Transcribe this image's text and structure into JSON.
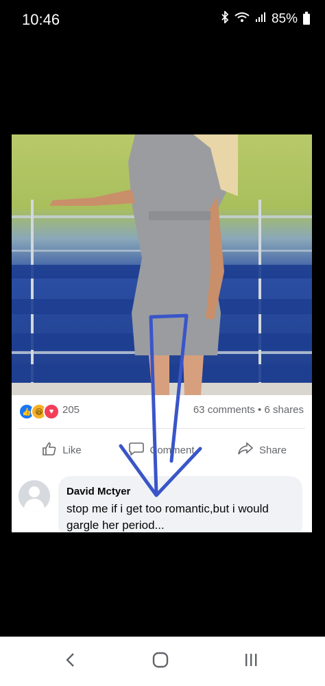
{
  "status_bar": {
    "time": "10:46",
    "battery_percent": "85%",
    "icons": [
      "bluetooth-icon",
      "wifi-icon",
      "signal-icon",
      "battery-icon"
    ]
  },
  "post": {
    "reaction_count": "205",
    "comments_shares": "63 comments • 6 shares",
    "reactions": [
      "like",
      "haha",
      "love"
    ],
    "actions": {
      "like": "Like",
      "comment": "Comment",
      "share": "Share"
    },
    "comment": {
      "author": "David Mctyer",
      "text": "stop me if i get too romantic,but i would gargle her period..."
    }
  },
  "colors": {
    "facebook_blue": "#1877f2",
    "annotation_arrow": "#3a55c8",
    "text_gray": "#65676b"
  },
  "nav_bar": {
    "buttons": [
      "back-icon",
      "home-icon",
      "recents-icon"
    ]
  }
}
